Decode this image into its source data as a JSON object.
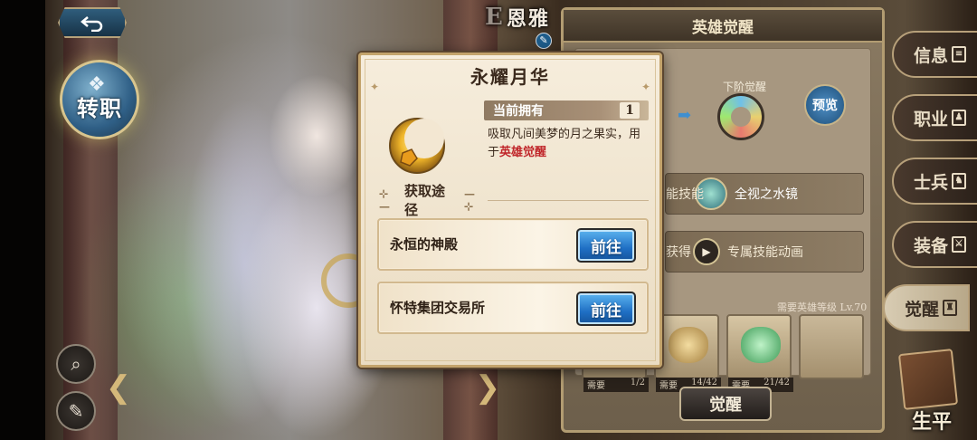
{
  "hero": {
    "rank_letter": "E",
    "name": "恩雅",
    "class_change_label": "转职"
  },
  "awakening_panel": {
    "title": "英雄觉醒",
    "next_stage_label": "下阶觉醒",
    "preview_label": "预览",
    "skill_prefix": "能技能",
    "skill_name": "全视之水镜",
    "anim_prefix": "获得",
    "anim_label": "专属技能动画",
    "level_requirement": "需要英雄等级 Lv.70",
    "materials": [
      {
        "need_label": "需要",
        "count": "1/2"
      },
      {
        "need_label": "需要",
        "count": "14/42"
      },
      {
        "need_label": "需要",
        "count": "21/42"
      }
    ],
    "awaken_button": "觉醒"
  },
  "side_tabs": [
    {
      "label": "信息",
      "icon": "info-icon",
      "active": false
    },
    {
      "label": "职业",
      "icon": "class-icon",
      "active": false
    },
    {
      "label": "士兵",
      "icon": "soldier-icon",
      "active": false
    },
    {
      "label": "装备",
      "icon": "equipment-icon",
      "active": false
    },
    {
      "label": "觉醒",
      "icon": "awaken-icon",
      "active": true
    }
  ],
  "biography_label": "生平",
  "item_modal": {
    "title": "永耀月华",
    "owned_label": "当前拥有",
    "owned_count": "1",
    "description_part1": "吸取凡间美梦的月之果实，用于",
    "description_highlight": "英雄觉醒",
    "source_header": "获取途径",
    "sources": [
      {
        "name": "永恒的神殿",
        "button": "前往"
      },
      {
        "name": "怀特集团交易所",
        "button": "前往"
      }
    ]
  },
  "colors": {
    "highlight_red": "#c0262a",
    "go_button_blue": "#1f6fc4",
    "panel_gold": "#c3a36b"
  }
}
